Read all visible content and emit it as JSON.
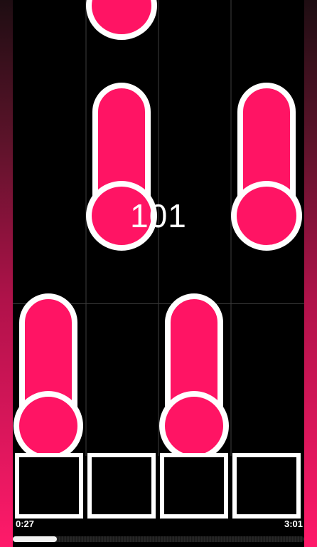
{
  "game": {
    "score": "101",
    "note_color": "#ff1464",
    "outline_color": "#ffffff",
    "background_color": "#000000"
  },
  "playback": {
    "elapsed": "0:27",
    "total": "3:01",
    "progress_fraction": 0.15
  }
}
